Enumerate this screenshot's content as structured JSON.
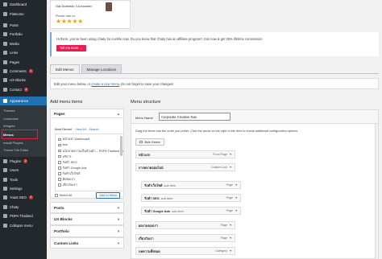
{
  "sidebar": {
    "items_top": [
      {
        "label": "Dashboard",
        "icon": "dashboard-icon"
      },
      {
        "label": "Flatsome",
        "icon": "flatsome-icon"
      },
      {
        "label": "Posts",
        "icon": "pin-icon"
      },
      {
        "label": "Portfolio",
        "icon": "portfolio-icon"
      },
      {
        "label": "Media",
        "icon": "media-icon"
      },
      {
        "label": "Links",
        "icon": "link-icon"
      },
      {
        "label": "Pages",
        "icon": "page-icon"
      },
      {
        "label": "Comments",
        "icon": "comment-icon",
        "badge": "1"
      },
      {
        "label": "UX Blocks",
        "icon": "blocks-icon"
      },
      {
        "label": "Contact",
        "icon": "mail-icon",
        "badge": "1"
      }
    ],
    "current": {
      "label": "Appearance",
      "icon": "brush-icon"
    },
    "submenu": [
      "Themes",
      "Customize",
      "Widgets",
      "Menus",
      "Install Plugins",
      "Theme File Editor"
    ],
    "items_bottom": [
      {
        "label": "Plugins",
        "icon": "plug-icon",
        "badge": "2"
      },
      {
        "label": "Users",
        "icon": "users-icon"
      },
      {
        "label": "Tools",
        "icon": "wrench-icon"
      },
      {
        "label": "Settings",
        "icon": "settings-icon"
      },
      {
        "label": "Yoast SEO",
        "icon": "yoast-icon",
        "badge": "1"
      },
      {
        "label": "Chaty",
        "icon": "chat-icon"
      },
      {
        "label": "PDPA Thailand",
        "icon": "shield-icon"
      },
      {
        "label": "Collapse menu",
        "icon": "collapse-icon"
      }
    ]
  },
  "review": {
    "name": "Gal Dubinski, Co-founder",
    "message": "Please rate us",
    "stars": "★★★★★"
  },
  "notice": {
    "text": "Hi there, you've been using Chaty for a while now. Do you know that Chaty has an affiliate program? Join now & get 25% lifetime commission",
    "button": "Tell me more →"
  },
  "tabs": [
    "Edit Menus",
    "Manage Locations"
  ],
  "edit_bar": {
    "prefix": "Edit your menu below, or ",
    "link": "create a new menu",
    "suffix": ". Do not forget to save your changes!"
  },
  "add_items": {
    "title": "Add menu items",
    "pages_label": "Pages",
    "page_tabs": [
      "Most Recent",
      "View All",
      "Search"
    ],
    "pages": [
      "หน้าแรก Dashboard",
      "test",
      "นโยบายความเป็นส่วนตัว – PDPA Thailand – Policy Page",
      "บริการ",
      "รับทำ SEO",
      "รับทำ Google Ads",
      "รับทำเว็บไซต์",
      "ติดต่อเรา",
      "เกี่ยวกับเรา"
    ],
    "select_all": "Select All",
    "add_button": "Add to Menu",
    "sections": [
      "Posts",
      "UX Blocks",
      "Portfolio",
      "Custom Links"
    ]
  },
  "structure": {
    "title": "Menu structure",
    "name_label": "Menu Name",
    "name_value": "Corporate Creative Nav",
    "instructions": "Drag the items into the order you prefer. Click the arrow on the right of the item to reveal additional configuration options.",
    "bulk_select": "Bulk Select",
    "items": [
      {
        "title": "หน้าแรก",
        "sub": "",
        "type": "Front Page",
        "level": 0
      },
      {
        "title": "การตลาดออนไลน์",
        "sub": "",
        "type": "Custom Link",
        "level": 0
      },
      {
        "title": "รับทำเว็บไซต์",
        "sub": "sub item",
        "type": "Page",
        "level": 1
      },
      {
        "title": "รับทำ SEO",
        "sub": "sub item",
        "type": "Page",
        "level": 1
      },
      {
        "title": "รับทำ Google Ads",
        "sub": "sub item",
        "type": "Page",
        "level": 1
      },
      {
        "title": "ผลงานของเรา",
        "sub": "",
        "type": "Page",
        "level": 0
      },
      {
        "title": "เกี่ยวกับเรา",
        "sub": "",
        "type": "Page",
        "level": 0
      },
      {
        "title": "บทความทั้งหมด",
        "sub": "",
        "type": "Category",
        "level": 0
      }
    ]
  }
}
